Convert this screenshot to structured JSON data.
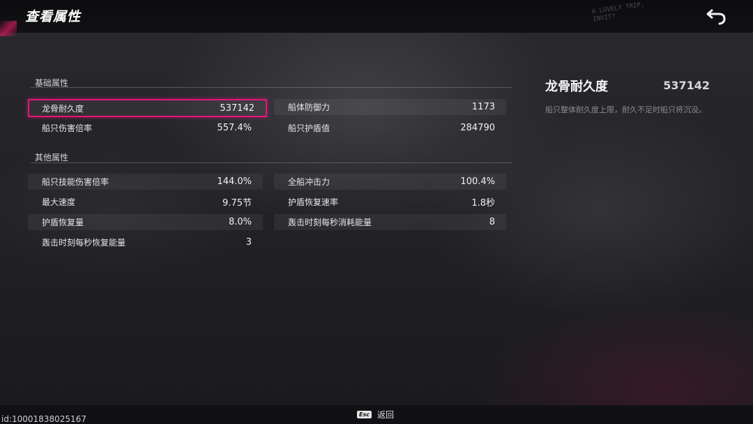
{
  "header": {
    "title": "查看属性",
    "scribble_text": "A LOVELY TRIP, INVIT?",
    "back_icon": "back-arrow-icon"
  },
  "sections": [
    {
      "title": "基础属性",
      "rows": [
        [
          {
            "label": "龙骨耐久度",
            "value": "537142",
            "selected": true
          },
          {
            "label": "船体防御力",
            "value": "1173"
          }
        ],
        [
          {
            "label": "船只伤害倍率",
            "value": "557.4%"
          },
          {
            "label": "船只护盾值",
            "value": "284790"
          }
        ]
      ]
    },
    {
      "title": "其他属性",
      "rows": [
        [
          {
            "label": "船只技能伤害倍率",
            "value": "144.0%"
          },
          {
            "label": "全船冲击力",
            "value": "100.4%"
          }
        ],
        [
          {
            "label": "最大速度",
            "value": "9.75节"
          },
          {
            "label": "护盾恢复速率",
            "value": "1.8秒"
          }
        ],
        [
          {
            "label": "护盾恢复量",
            "value": "8.0%"
          },
          {
            "label": "轰击时刻每秒消耗能量",
            "value": "8"
          }
        ],
        [
          {
            "label": "轰击时刻每秒恢复能量",
            "value": "3"
          }
        ]
      ]
    }
  ],
  "detail": {
    "name": "龙骨耐久度",
    "value": "537142",
    "description": "船只整体耐久度上限，耐久不足时船只将沉没。"
  },
  "footer": {
    "esc_key": "Esc",
    "back_label": "返回",
    "uid": "id:10001838025167"
  },
  "colors": {
    "accent": "#e5167a",
    "background": "#232326"
  }
}
